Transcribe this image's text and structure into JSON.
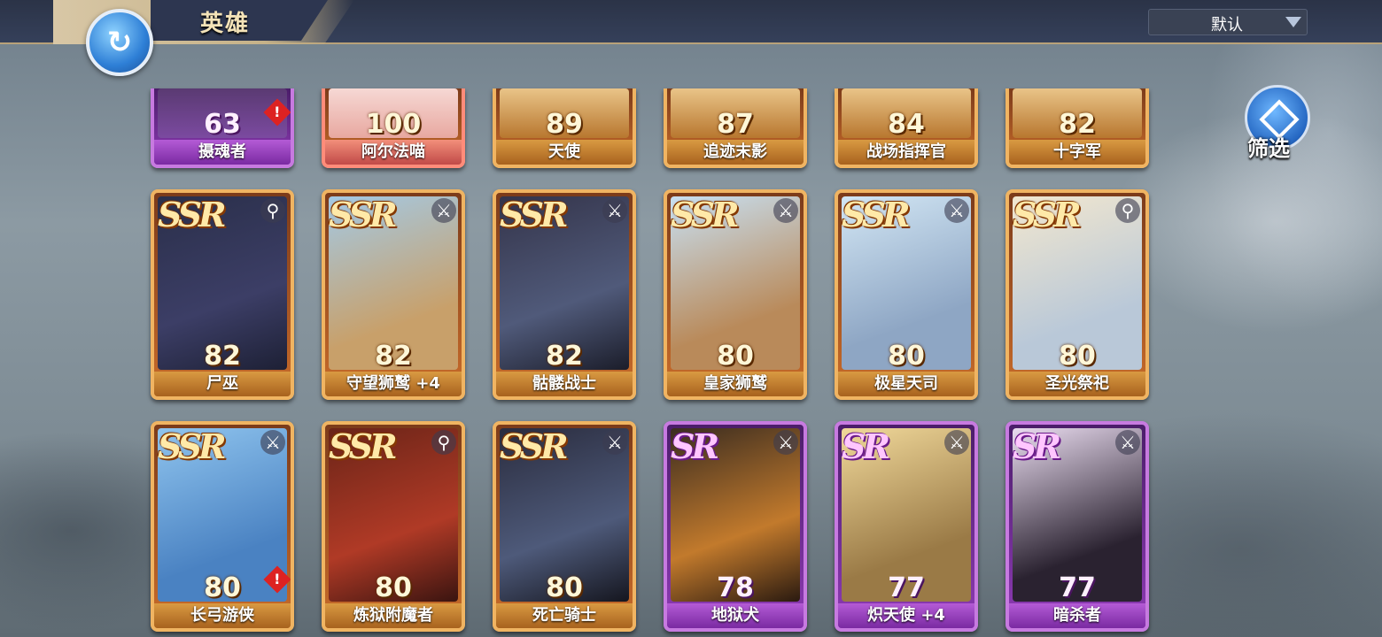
{
  "header": {
    "title": "英雄",
    "sort_value": "默认"
  },
  "filter": {
    "label": "筛选"
  },
  "cards": [
    {
      "name": "摄魂者",
      "level": "63",
      "rarity": "",
      "class": "",
      "alert": "!",
      "style": "purple-top"
    },
    {
      "name": "阿尔法喵",
      "level": "100",
      "rarity": "",
      "class": "",
      "alert": "",
      "style": "pink-top"
    },
    {
      "name": "天使",
      "level": "89",
      "rarity": "",
      "class": "",
      "alert": "",
      "style": "ssr-top"
    },
    {
      "name": "追迹末影",
      "level": "87",
      "rarity": "",
      "class": "",
      "alert": "",
      "style": "ssr-top"
    },
    {
      "name": "战场指挥官",
      "level": "84",
      "rarity": "",
      "class": "",
      "alert": "",
      "style": "ssr-top"
    },
    {
      "name": "十字军",
      "level": "82",
      "rarity": "",
      "class": "",
      "alert": "",
      "style": "ssr-top"
    },
    {
      "name": "尸巫",
      "level": "82",
      "rarity": "SSR",
      "class": "staff",
      "alert": ""
    },
    {
      "name": "守望狮鹫 +4",
      "level": "82",
      "rarity": "SSR",
      "class": "swords",
      "alert": ""
    },
    {
      "name": "骷髅战士",
      "level": "82",
      "rarity": "SSR",
      "class": "swords",
      "alert": ""
    },
    {
      "name": "皇家狮鹫",
      "level": "80",
      "rarity": "SSR",
      "class": "swords",
      "alert": ""
    },
    {
      "name": "极星天司",
      "level": "80",
      "rarity": "SSR",
      "class": "swords",
      "alert": ""
    },
    {
      "name": "圣光祭祀",
      "level": "80",
      "rarity": "SSR",
      "class": "staff",
      "alert": ""
    },
    {
      "name": "长弓游侠",
      "level": "80",
      "rarity": "SSR",
      "class": "swords",
      "alert": "!"
    },
    {
      "name": "炼狱附魔者",
      "level": "80",
      "rarity": "SSR",
      "class": "staff",
      "alert": ""
    },
    {
      "name": "死亡骑士",
      "level": "80",
      "rarity": "SSR",
      "class": "swords",
      "alert": ""
    },
    {
      "name": "地狱犬",
      "level": "78",
      "rarity": "SR",
      "class": "swords",
      "alert": ""
    },
    {
      "name": "炽天使 +4",
      "level": "77",
      "rarity": "SR",
      "class": "swords",
      "alert": ""
    },
    {
      "name": "暗杀者",
      "level": "77",
      "rarity": "SR",
      "class": "swords",
      "alert": ""
    }
  ],
  "icons": {
    "staff": "⚲",
    "swords": "⚔",
    "back": "↻"
  }
}
